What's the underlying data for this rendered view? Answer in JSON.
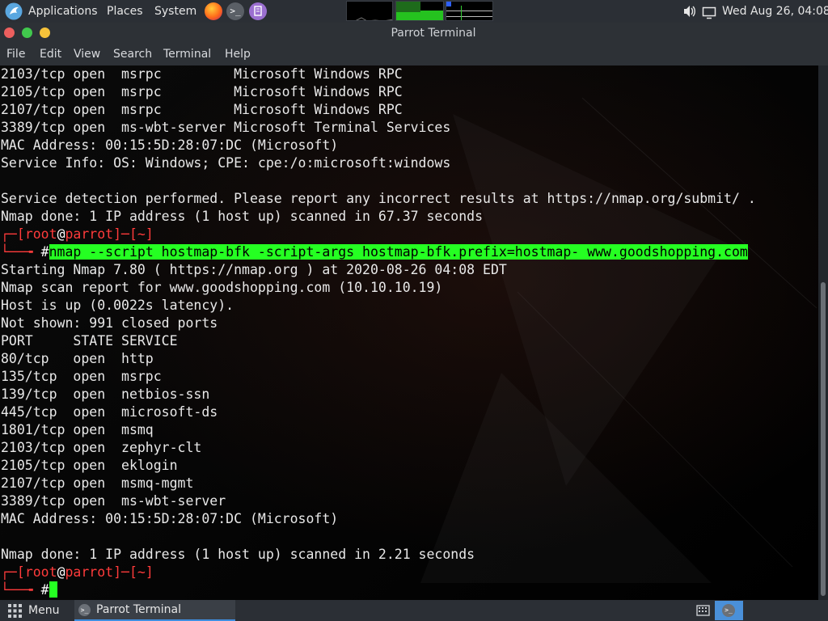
{
  "top_panel": {
    "applications": "Applications",
    "places": "Places",
    "system": "System",
    "clock": "Wed Aug 26, 04:08"
  },
  "window": {
    "title": "Parrot Terminal"
  },
  "menu": {
    "file": "File",
    "edit": "Edit",
    "view": "View",
    "search": "Search",
    "terminal": "Terminal",
    "help": "Help"
  },
  "terminal": {
    "lines_before": [
      "2103/tcp open  msrpc         Microsoft Windows RPC",
      "2105/tcp open  msrpc         Microsoft Windows RPC",
      "2107/tcp open  msrpc         Microsoft Windows RPC",
      "3389/tcp open  ms-wbt-server Microsoft Terminal Services",
      "MAC Address: 00:15:5D:28:07:DC (Microsoft)",
      "Service Info: OS: Windows; CPE: cpe:/o:microsoft:windows",
      "",
      "Service detection performed. Please report any incorrect results at https://nmap.org/submit/ .",
      "Nmap done: 1 IP address (1 host up) scanned in 67.37 seconds"
    ],
    "prompt": {
      "user": "root",
      "at": "@",
      "host": "parrot",
      "dir": "~",
      "symbol": "#"
    },
    "command": "nmap --script hostmap-bfk -script-args hostmap-bfk.prefix=hostmap- www.goodshopping.com",
    "lines_after": [
      "Starting Nmap 7.80 ( https://nmap.org ) at 2020-08-26 04:08 EDT",
      "Nmap scan report for www.goodshopping.com (10.10.10.19)",
      "Host is up (0.0022s latency).",
      "Not shown: 991 closed ports",
      "PORT     STATE SERVICE",
      "80/tcp   open  http",
      "135/tcp  open  msrpc",
      "139/tcp  open  netbios-ssn",
      "445/tcp  open  microsoft-ds",
      "1801/tcp open  msmq",
      "2103/tcp open  zephyr-clt",
      "2105/tcp open  eklogin",
      "2107/tcp open  msmq-mgmt",
      "3389/tcp open  ms-wbt-server",
      "MAC Address: 00:15:5D:28:07:DC (Microsoft)",
      "",
      "Nmap done: 1 IP address (1 host up) scanned in 2.21 seconds"
    ]
  },
  "taskbar": {
    "menu": "Menu",
    "task": "Parrot Terminal"
  },
  "colors": {
    "prompt_red": "#ff3b3b",
    "highlight_green": "#25ff22",
    "close": "#ec5f5e",
    "minimize": "#41c84d",
    "maximize": "#f5c23a"
  },
  "icons": [
    "parrot-logo-icon",
    "firefox-icon",
    "terminal-launcher-icon",
    "text-editor-icon",
    "volume-icon",
    "display-icon",
    "grid-menu-icon",
    "keyboard-icon"
  ]
}
